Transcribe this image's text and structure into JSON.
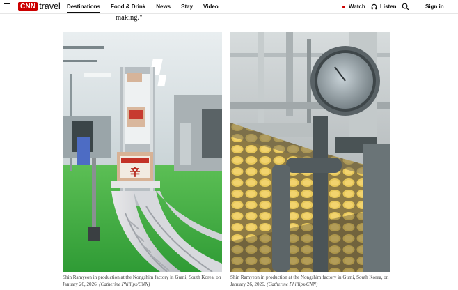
{
  "nav": {
    "logo_badge": "CNN",
    "logo_text": "travel",
    "links": [
      "Destinations",
      "Food & Drink",
      "News",
      "Stay",
      "Video"
    ],
    "active": "Destinations",
    "watch": "Watch",
    "listen": "Listen",
    "sign_in": "Sign in"
  },
  "article": {
    "lead_text": "making.\"",
    "photos": [
      {
        "caption": "Shin Ramyeon in production at the Nongshim factory in Gumi, South Korea, on January 26, 2026.",
        "credit": "(Catherine Phillips/CNN)",
        "box_label": "辛"
      },
      {
        "caption": "Shin Ramyeon in production at the Nongshim factory in Gumi, South Korea, on January 26, 2026.",
        "credit": "(Catherine Phillips/CNN)"
      }
    ]
  },
  "colors": {
    "brand_red": "#cc0000",
    "factory_floor_green": "#3fae3a",
    "noodle_yellow": "#e6c74a"
  },
  "icons": [
    "hamburger-menu-icon",
    "live-dot-icon",
    "headphones-icon",
    "search-icon"
  ]
}
